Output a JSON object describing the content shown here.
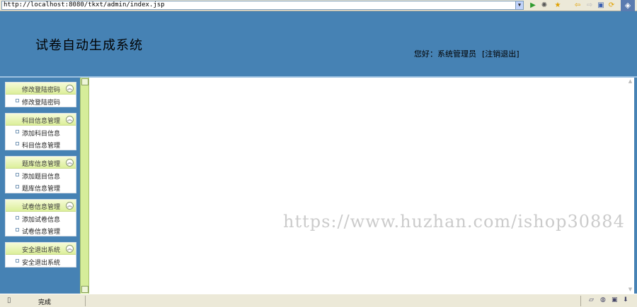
{
  "browser": {
    "url": "http://localhost:8080/tkxt/admin/index.jsp"
  },
  "header": {
    "title": "试卷自动生成系统",
    "greeting": "您好：系统管理员",
    "logout": "[注销退出]"
  },
  "sidebar": {
    "groups": [
      {
        "title": "修改登陆密码",
        "items": [
          "修改登陆密码"
        ]
      },
      {
        "title": "科目信息管理",
        "items": [
          "添加科目信息",
          "科目信息管理"
        ]
      },
      {
        "title": "题库信息管理",
        "items": [
          "添加题目信息",
          "题库信息管理"
        ]
      },
      {
        "title": "试卷信息管理",
        "items": [
          "添加试卷信息",
          "试卷信息管理"
        ]
      },
      {
        "title": "安全退出系统",
        "items": [
          "安全退出系统"
        ]
      }
    ]
  },
  "content": {
    "watermark": "https://www.huzhan.com/ishop30884"
  },
  "status": {
    "text": "完成"
  },
  "colors": {
    "header_bg": "#4682b4",
    "group_header": "#dcef9a",
    "splitter": "#d6ed9a"
  },
  "icons": {
    "go": "go-arrow-icon",
    "settings": "gear-icon",
    "favorites": "star-icon",
    "back": "back-arrow-icon",
    "forward": "forward-arrow-icon",
    "refresh": "refresh-icon",
    "collapse": "chevron-up-icon",
    "bullet": "square-bullet-icon"
  }
}
